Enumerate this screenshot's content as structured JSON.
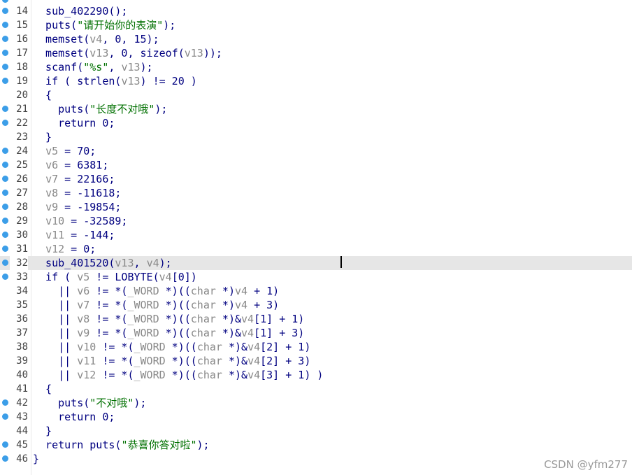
{
  "editor": {
    "colors": {
      "keyword": "#000080",
      "variable": "#888888",
      "string": "#007000",
      "breakpoint": "#3c9ee8",
      "current_line": "#e6e6e6"
    },
    "current_line_number": "32",
    "lines": [
      {
        "n": "14",
        "bp": true,
        "tokens": [
          {
            "t": "  sub_402290();",
            "c": "kw"
          }
        ]
      },
      {
        "n": "15",
        "bp": true,
        "tokens": [
          {
            "t": "  puts(",
            "c": "kw"
          },
          {
            "t": "\"请开始你的表演\"",
            "c": "str"
          },
          {
            "t": ");",
            "c": "kw"
          }
        ]
      },
      {
        "n": "16",
        "bp": true,
        "tokens": [
          {
            "t": "  memset(",
            "c": "kw"
          },
          {
            "t": "v4",
            "c": "var"
          },
          {
            "t": ", 0, 15);",
            "c": "kw"
          }
        ]
      },
      {
        "n": "17",
        "bp": true,
        "tokens": [
          {
            "t": "  memset(",
            "c": "kw"
          },
          {
            "t": "v13",
            "c": "var"
          },
          {
            "t": ", 0, sizeof(",
            "c": "kw"
          },
          {
            "t": "v13",
            "c": "var"
          },
          {
            "t": "));",
            "c": "kw"
          }
        ]
      },
      {
        "n": "18",
        "bp": true,
        "tokens": [
          {
            "t": "  scanf(",
            "c": "kw"
          },
          {
            "t": "\"%s\"",
            "c": "str"
          },
          {
            "t": ", ",
            "c": "kw"
          },
          {
            "t": "v13",
            "c": "var"
          },
          {
            "t": ");",
            "c": "kw"
          }
        ]
      },
      {
        "n": "19",
        "bp": true,
        "tokens": [
          {
            "t": "  if ( strlen(",
            "c": "kw"
          },
          {
            "t": "v13",
            "c": "var"
          },
          {
            "t": ") != 20 )",
            "c": "kw"
          }
        ]
      },
      {
        "n": "20",
        "bp": false,
        "tokens": [
          {
            "t": "  {",
            "c": "kw"
          }
        ]
      },
      {
        "n": "21",
        "bp": true,
        "tokens": [
          {
            "t": "    puts(",
            "c": "kw"
          },
          {
            "t": "\"长度不对哦\"",
            "c": "str"
          },
          {
            "t": ");",
            "c": "kw"
          }
        ]
      },
      {
        "n": "22",
        "bp": true,
        "tokens": [
          {
            "t": "    return 0;",
            "c": "kw"
          }
        ]
      },
      {
        "n": "23",
        "bp": false,
        "tokens": [
          {
            "t": "  }",
            "c": "kw"
          }
        ]
      },
      {
        "n": "24",
        "bp": true,
        "tokens": [
          {
            "t": "  ",
            "c": "kw"
          },
          {
            "t": "v5",
            "c": "var"
          },
          {
            "t": " = 70;",
            "c": "kw"
          }
        ]
      },
      {
        "n": "25",
        "bp": true,
        "tokens": [
          {
            "t": "  ",
            "c": "kw"
          },
          {
            "t": "v6",
            "c": "var"
          },
          {
            "t": " = 6381;",
            "c": "kw"
          }
        ]
      },
      {
        "n": "26",
        "bp": true,
        "tokens": [
          {
            "t": "  ",
            "c": "kw"
          },
          {
            "t": "v7",
            "c": "var"
          },
          {
            "t": " = 22166;",
            "c": "kw"
          }
        ]
      },
      {
        "n": "27",
        "bp": true,
        "tokens": [
          {
            "t": "  ",
            "c": "kw"
          },
          {
            "t": "v8",
            "c": "var"
          },
          {
            "t": " = -11618;",
            "c": "kw"
          }
        ]
      },
      {
        "n": "28",
        "bp": true,
        "tokens": [
          {
            "t": "  ",
            "c": "kw"
          },
          {
            "t": "v9",
            "c": "var"
          },
          {
            "t": " = -19854;",
            "c": "kw"
          }
        ]
      },
      {
        "n": "29",
        "bp": true,
        "tokens": [
          {
            "t": "  ",
            "c": "kw"
          },
          {
            "t": "v10",
            "c": "var"
          },
          {
            "t": " = -32589;",
            "c": "kw"
          }
        ]
      },
      {
        "n": "30",
        "bp": true,
        "tokens": [
          {
            "t": "  ",
            "c": "kw"
          },
          {
            "t": "v11",
            "c": "var"
          },
          {
            "t": " = -144;",
            "c": "kw"
          }
        ]
      },
      {
        "n": "31",
        "bp": true,
        "tokens": [
          {
            "t": "  ",
            "c": "kw"
          },
          {
            "t": "v12",
            "c": "var"
          },
          {
            "t": " = 0;",
            "c": "kw"
          }
        ]
      },
      {
        "n": "32",
        "bp": true,
        "tokens": [
          {
            "t": "  sub_401520(",
            "c": "kw"
          },
          {
            "t": "v13",
            "c": "var"
          },
          {
            "t": ", ",
            "c": "kw"
          },
          {
            "t": "v4",
            "c": "var"
          },
          {
            "t": ");",
            "c": "kw"
          }
        ]
      },
      {
        "n": "33",
        "bp": true,
        "tokens": [
          {
            "t": "  if ( ",
            "c": "kw"
          },
          {
            "t": "v5",
            "c": "var"
          },
          {
            "t": " != LOBYTE(",
            "c": "kw"
          },
          {
            "t": "v4",
            "c": "var"
          },
          {
            "t": "[0])",
            "c": "kw"
          }
        ]
      },
      {
        "n": "34",
        "bp": false,
        "tokens": [
          {
            "t": "    || ",
            "c": "kw"
          },
          {
            "t": "v6",
            "c": "var"
          },
          {
            "t": " != *(",
            "c": "kw"
          },
          {
            "t": "_WORD",
            "c": "var"
          },
          {
            "t": " *)((",
            "c": "kw"
          },
          {
            "t": "char",
            "c": "var"
          },
          {
            "t": " *)",
            "c": "kw"
          },
          {
            "t": "v4",
            "c": "var"
          },
          {
            "t": " + 1)",
            "c": "kw"
          }
        ]
      },
      {
        "n": "35",
        "bp": false,
        "tokens": [
          {
            "t": "    || ",
            "c": "kw"
          },
          {
            "t": "v7",
            "c": "var"
          },
          {
            "t": " != *(",
            "c": "kw"
          },
          {
            "t": "_WORD",
            "c": "var"
          },
          {
            "t": " *)((",
            "c": "kw"
          },
          {
            "t": "char",
            "c": "var"
          },
          {
            "t": " *)",
            "c": "kw"
          },
          {
            "t": "v4",
            "c": "var"
          },
          {
            "t": " + 3)",
            "c": "kw"
          }
        ]
      },
      {
        "n": "36",
        "bp": false,
        "tokens": [
          {
            "t": "    || ",
            "c": "kw"
          },
          {
            "t": "v8",
            "c": "var"
          },
          {
            "t": " != *(",
            "c": "kw"
          },
          {
            "t": "_WORD",
            "c": "var"
          },
          {
            "t": " *)((",
            "c": "kw"
          },
          {
            "t": "char",
            "c": "var"
          },
          {
            "t": " *)&",
            "c": "kw"
          },
          {
            "t": "v4",
            "c": "var"
          },
          {
            "t": "[1] + 1)",
            "c": "kw"
          }
        ]
      },
      {
        "n": "37",
        "bp": false,
        "tokens": [
          {
            "t": "    || ",
            "c": "kw"
          },
          {
            "t": "v9",
            "c": "var"
          },
          {
            "t": " != *(",
            "c": "kw"
          },
          {
            "t": "_WORD",
            "c": "var"
          },
          {
            "t": " *)((",
            "c": "kw"
          },
          {
            "t": "char",
            "c": "var"
          },
          {
            "t": " *)&",
            "c": "kw"
          },
          {
            "t": "v4",
            "c": "var"
          },
          {
            "t": "[1] + 3)",
            "c": "kw"
          }
        ]
      },
      {
        "n": "38",
        "bp": false,
        "tokens": [
          {
            "t": "    || ",
            "c": "kw"
          },
          {
            "t": "v10",
            "c": "var"
          },
          {
            "t": " != *(",
            "c": "kw"
          },
          {
            "t": "_WORD",
            "c": "var"
          },
          {
            "t": " *)((",
            "c": "kw"
          },
          {
            "t": "char",
            "c": "var"
          },
          {
            "t": " *)&",
            "c": "kw"
          },
          {
            "t": "v4",
            "c": "var"
          },
          {
            "t": "[2] + 1)",
            "c": "kw"
          }
        ]
      },
      {
        "n": "39",
        "bp": false,
        "tokens": [
          {
            "t": "    || ",
            "c": "kw"
          },
          {
            "t": "v11",
            "c": "var"
          },
          {
            "t": " != *(",
            "c": "kw"
          },
          {
            "t": "_WORD",
            "c": "var"
          },
          {
            "t": " *)((",
            "c": "kw"
          },
          {
            "t": "char",
            "c": "var"
          },
          {
            "t": " *)&",
            "c": "kw"
          },
          {
            "t": "v4",
            "c": "var"
          },
          {
            "t": "[2] + 3)",
            "c": "kw"
          }
        ]
      },
      {
        "n": "40",
        "bp": false,
        "tokens": [
          {
            "t": "    || ",
            "c": "kw"
          },
          {
            "t": "v12",
            "c": "var"
          },
          {
            "t": " != *(",
            "c": "kw"
          },
          {
            "t": "_WORD",
            "c": "var"
          },
          {
            "t": " *)((",
            "c": "kw"
          },
          {
            "t": "char",
            "c": "var"
          },
          {
            "t": " *)&",
            "c": "kw"
          },
          {
            "t": "v4",
            "c": "var"
          },
          {
            "t": "[3] + 1) )",
            "c": "kw"
          }
        ]
      },
      {
        "n": "41",
        "bp": false,
        "tokens": [
          {
            "t": "  {",
            "c": "kw"
          }
        ]
      },
      {
        "n": "42",
        "bp": true,
        "tokens": [
          {
            "t": "    puts(",
            "c": "kw"
          },
          {
            "t": "\"不对哦\"",
            "c": "str"
          },
          {
            "t": ");",
            "c": "kw"
          }
        ]
      },
      {
        "n": "43",
        "bp": true,
        "tokens": [
          {
            "t": "    return 0;",
            "c": "kw"
          }
        ]
      },
      {
        "n": "44",
        "bp": false,
        "tokens": [
          {
            "t": "  }",
            "c": "kw"
          }
        ]
      },
      {
        "n": "45",
        "bp": true,
        "tokens": [
          {
            "t": "  return puts(",
            "c": "kw"
          },
          {
            "t": "\"恭喜你答对啦\"",
            "c": "str"
          },
          {
            "t": ");",
            "c": "kw"
          }
        ]
      },
      {
        "n": "46",
        "bp": true,
        "tokens": [
          {
            "t": "}",
            "c": "kw"
          }
        ]
      }
    ]
  },
  "watermark": "CSDN @yfm277"
}
